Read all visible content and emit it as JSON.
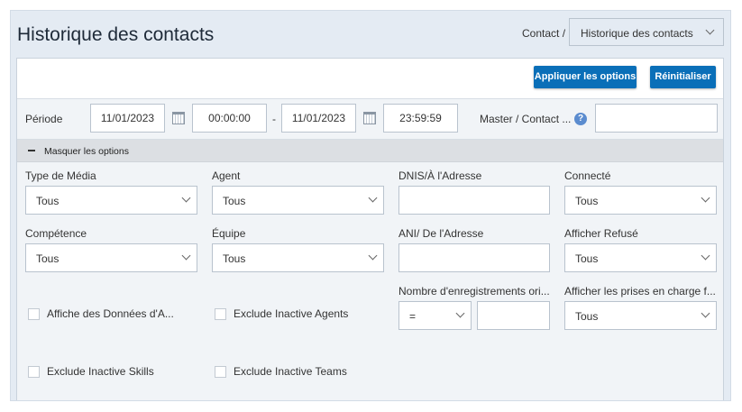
{
  "header": {
    "title": "Historique des contacts",
    "breadcrumb_prefix": "Contact /",
    "breadcrumb_selected": "Historique des contacts"
  },
  "toolbar": {
    "apply_label": "Appliquer les options",
    "reset_label": "Réinitialiser"
  },
  "period": {
    "label": "Période",
    "start_date": "11/01/2023",
    "start_time": "00:00:00",
    "separator": "-",
    "end_date": "11/01/2023",
    "end_time": "23:59:59",
    "master_label": "Master / Contact ...",
    "master_value": ""
  },
  "options": {
    "toggle_label": "Masquer les options",
    "media_type": {
      "label": "Type de Média",
      "value": "Tous"
    },
    "agent": {
      "label": "Agent",
      "value": "Tous"
    },
    "dnis": {
      "label": "DNIS/À l'Adresse",
      "value": ""
    },
    "connected": {
      "label": "Connecté",
      "value": "Tous"
    },
    "skill": {
      "label": "Compétence",
      "value": "Tous"
    },
    "team": {
      "label": "Équipe",
      "value": "Tous"
    },
    "ani": {
      "label": "ANI/ De l'Adresse",
      "value": ""
    },
    "show_refused": {
      "label": "Afficher Refusé",
      "value": "Tous"
    },
    "record_count": {
      "label": "Nombre d'enregistrements ori...",
      "operator": "=",
      "value": ""
    },
    "show_handled": {
      "label": "Afficher les prises en charge f...",
      "value": "Tous"
    },
    "checkboxes": [
      {
        "label": "Affiche des Données d'A...",
        "checked": false
      },
      {
        "label": "Exclude Inactive Agents",
        "checked": false
      },
      {
        "label": "Exclude Inactive Skills",
        "checked": false
      },
      {
        "label": "Exclude Inactive Teams",
        "checked": false
      }
    ]
  },
  "colors": {
    "accent": "#0a6fb8",
    "frame_bg": "#e4ebf3",
    "bar_bg": "#f1f4f7"
  },
  "icons": [
    "calendar-icon",
    "help-icon",
    "chevron-down-icon",
    "minus-icon"
  ]
}
